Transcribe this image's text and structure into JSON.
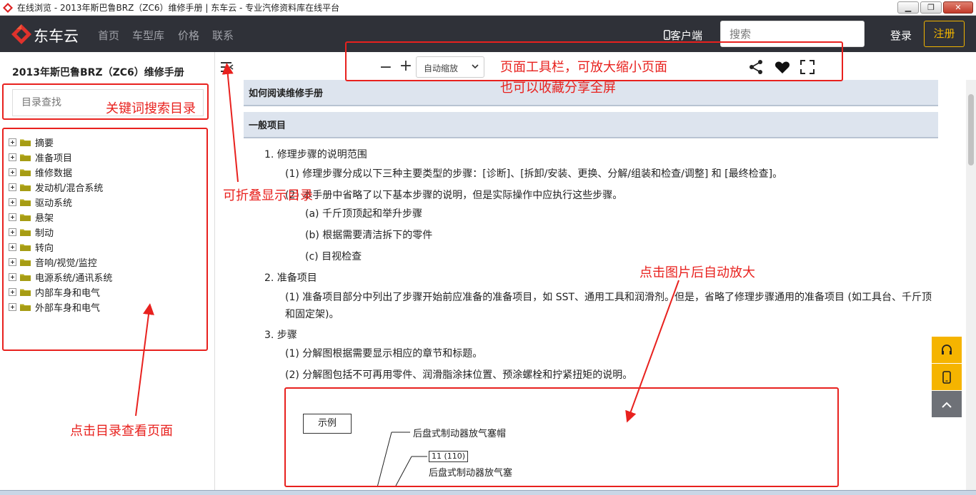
{
  "window": {
    "title": "在线浏览 - 2013年斯巴鲁BRZ（ZC6）维修手册 | 东车云 - 专业汽修资料库在线平台",
    "min": "0",
    "max": "1",
    "close": "r"
  },
  "nav": {
    "brand": "东车云",
    "links": [
      "首页",
      "车型库",
      "价格",
      "联系"
    ],
    "client": "客户端",
    "search_placeholder": "搜索",
    "login": "登录",
    "register": "注册"
  },
  "sidebar": {
    "title": "2013年斯巴鲁BRZ（ZC6）维修手册",
    "search_placeholder": "目录查找",
    "items": [
      "摘要",
      "准备项目",
      "维修数据",
      "发动机/混合系统",
      "驱动系统",
      "悬架",
      "制动",
      "转向",
      "音响/视觉/监控",
      "电源系统/通讯系统",
      "内部车身和电气",
      "外部车身和电气"
    ]
  },
  "toolbar": {
    "zoom_out": "−",
    "zoom_in": "+",
    "zoom_mode": "自动缩放"
  },
  "content": {
    "section1": "如何阅读维修手册",
    "section2": "一般项目",
    "lines": [
      "1. 修理步骤的说明范围",
      "(1) 修理步骤分成以下三种主要类型的步骤：[诊断]、[拆卸/安装、更换、分解/组装和检查/调整] 和 [最终检查]。",
      "(2) 本手册中省略了以下基本步骤的说明，但是实际操作中应执行这些步骤。",
      "(a) 千斤顶顶起和举升步骤",
      "(b) 根据需要清洁拆下的零件",
      "(c) 目视检查",
      "2. 准备项目",
      "(1) 准备项目部分中列出了步骤开始前应准备的准备项目，如 SST、通用工具和润滑剂。但是，省略了修理步骤通用的准备项目 (如工具台、千斤顶和固定架)。",
      "3. 步骤",
      "(1) 分解图根据需要显示相应的章节和标题。",
      "(2) 分解图包括不可再用零件、润滑脂涂抹位置、预涂螺栓和拧紧扭矩的说明。"
    ],
    "figure": {
      "example": "示例",
      "label1": "后盘式制动器放气塞帽",
      "torque": "11 (110)",
      "label2": "后盘式制动器放气塞"
    }
  },
  "annotations": {
    "toolbar": "页面工具栏，可放大缩小页面",
    "toolbar2": "也可以收藏分享全屏",
    "search": "关键词搜索目录",
    "collapse": "可折叠显示目录",
    "image": "点击图片后自动放大",
    "toc": "点击目录查看页面"
  },
  "colors": {
    "nav_bg": "#2f3138",
    "accent": "#f1b400",
    "annotation": "#e8211e",
    "section_bg": "#dde4ee"
  }
}
